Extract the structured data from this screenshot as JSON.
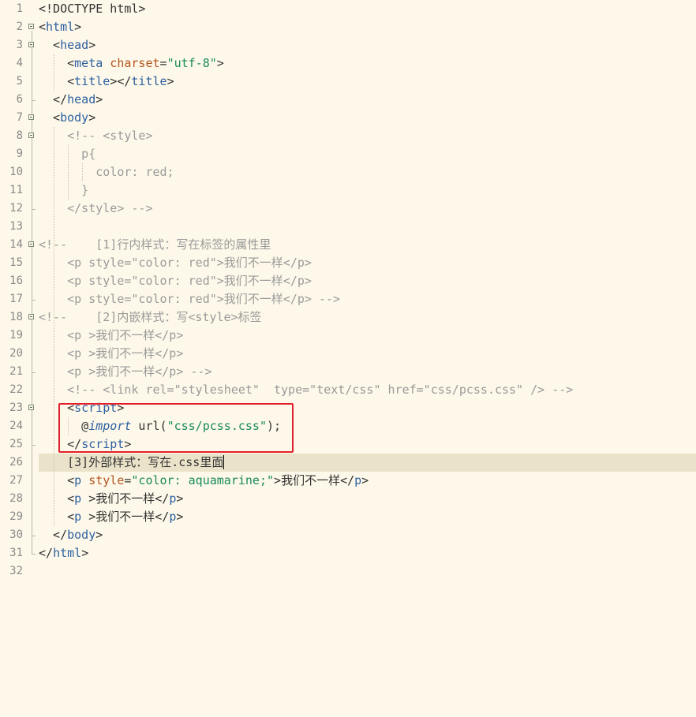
{
  "editor": {
    "line_numbers": [
      "1",
      "2",
      "3",
      "4",
      "5",
      "6",
      "7",
      "8",
      "9",
      "10",
      "11",
      "12",
      "13",
      "14",
      "15",
      "16",
      "17",
      "18",
      "19",
      "20",
      "21",
      "22",
      "23",
      "24",
      "25",
      "26",
      "27",
      "28",
      "29",
      "30",
      "31",
      "32"
    ],
    "lines": [
      [
        {
          "t": "punct",
          "s": "<!DOCTYPE html>"
        }
      ],
      [
        {
          "t": "punct",
          "s": "<"
        },
        {
          "t": "tag",
          "s": "html"
        },
        {
          "t": "punct",
          "s": ">"
        }
      ],
      [
        {
          "t": "punct",
          "s": "  <"
        },
        {
          "t": "tag",
          "s": "head"
        },
        {
          "t": "punct",
          "s": ">"
        }
      ],
      [
        {
          "t": "punct",
          "s": "    <"
        },
        {
          "t": "tag",
          "s": "meta"
        },
        {
          "t": "plain",
          "s": " "
        },
        {
          "t": "attrx",
          "s": "charset"
        },
        {
          "t": "punct",
          "s": "="
        },
        {
          "t": "str",
          "s": "\"utf-8\""
        },
        {
          "t": "punct",
          "s": ">"
        }
      ],
      [
        {
          "t": "punct",
          "s": "    <"
        },
        {
          "t": "tag",
          "s": "title"
        },
        {
          "t": "punct",
          "s": "></"
        },
        {
          "t": "tag",
          "s": "title"
        },
        {
          "t": "punct",
          "s": ">"
        }
      ],
      [
        {
          "t": "punct",
          "s": "  </"
        },
        {
          "t": "tag",
          "s": "head"
        },
        {
          "t": "punct",
          "s": ">"
        }
      ],
      [
        {
          "t": "punct",
          "s": "  <"
        },
        {
          "t": "tag",
          "s": "body"
        },
        {
          "t": "punct",
          "s": ">"
        }
      ],
      [
        {
          "t": "cm",
          "s": "    <!-- <style>"
        }
      ],
      [
        {
          "t": "cm",
          "s": "      p{"
        }
      ],
      [
        {
          "t": "cm",
          "s": "        color: red;"
        }
      ],
      [
        {
          "t": "cm",
          "s": "      }"
        }
      ],
      [
        {
          "t": "cm",
          "s": "    </style> -->"
        }
      ],
      [],
      [
        {
          "t": "cm",
          "s": "<!--    [1]行内样式：写在标签的属性里"
        }
      ],
      [
        {
          "t": "cm",
          "s": "    <p style=\"color: red\">我们不一样</p>"
        }
      ],
      [
        {
          "t": "cm",
          "s": "    <p style=\"color: red\">我们不一样</p>"
        }
      ],
      [
        {
          "t": "cm",
          "s": "    <p style=\"color: red\">我们不一样</p> -->"
        }
      ],
      [
        {
          "t": "cm",
          "s": "<!--    [2]内嵌样式：写<style>标签"
        }
      ],
      [
        {
          "t": "cm",
          "s": "    <p >我们不一样</p>"
        }
      ],
      [
        {
          "t": "cm",
          "s": "    <p >我们不一样</p>"
        }
      ],
      [
        {
          "t": "cm",
          "s": "    <p >我们不一样</p> -->"
        }
      ],
      [
        {
          "t": "cm",
          "s": "    <!-- <link rel=\"stylesheet\"  type=\"text/css\" href=\"css/pcss.css\" /> -->"
        }
      ],
      [
        {
          "t": "punct",
          "s": "    <"
        },
        {
          "t": "tag",
          "s": "script"
        },
        {
          "t": "punct",
          "s": ">"
        }
      ],
      [
        {
          "t": "plain",
          "s": "      @"
        },
        {
          "t": "kw",
          "s": "import"
        },
        {
          "t": "plain",
          "s": " url("
        },
        {
          "t": "str",
          "s": "\"css/pcss.css\""
        },
        {
          "t": "plain",
          "s": ");"
        }
      ],
      [
        {
          "t": "punct",
          "s": "    </"
        },
        {
          "t": "tag",
          "s": "script"
        },
        {
          "t": "punct",
          "s": ">"
        }
      ],
      [
        {
          "t": "text",
          "s": "    [3]外部样式：写在.css里面"
        }
      ],
      [
        {
          "t": "punct",
          "s": "    <"
        },
        {
          "t": "tag",
          "s": "p"
        },
        {
          "t": "plain",
          "s": " "
        },
        {
          "t": "attrx",
          "s": "style"
        },
        {
          "t": "punct",
          "s": "="
        },
        {
          "t": "str",
          "s": "\"color: aquamarine;\""
        },
        {
          "t": "punct",
          "s": ">"
        },
        {
          "t": "text",
          "s": "我们不一样"
        },
        {
          "t": "punct",
          "s": "</"
        },
        {
          "t": "tag",
          "s": "p"
        },
        {
          "t": "punct",
          "s": ">"
        }
      ],
      [
        {
          "t": "punct",
          "s": "    <"
        },
        {
          "t": "tag",
          "s": "p"
        },
        {
          "t": "plain",
          "s": " "
        },
        {
          "t": "punct",
          "s": ">"
        },
        {
          "t": "text",
          "s": "我们不一样"
        },
        {
          "t": "punct",
          "s": "</"
        },
        {
          "t": "tag",
          "s": "p"
        },
        {
          "t": "punct",
          "s": ">"
        }
      ],
      [
        {
          "t": "punct",
          "s": "    <"
        },
        {
          "t": "tag",
          "s": "p"
        },
        {
          "t": "plain",
          "s": " "
        },
        {
          "t": "punct",
          "s": ">"
        },
        {
          "t": "text",
          "s": "我们不一样"
        },
        {
          "t": "punct",
          "s": "</"
        },
        {
          "t": "tag",
          "s": "p"
        },
        {
          "t": "punct",
          "s": ">"
        }
      ],
      [
        {
          "t": "punct",
          "s": "  </"
        },
        {
          "t": "tag",
          "s": "body"
        },
        {
          "t": "punct",
          "s": ">"
        }
      ],
      [
        {
          "t": "punct",
          "s": "</"
        },
        {
          "t": "tag",
          "s": "html"
        },
        {
          "t": "punct",
          "s": ">"
        }
      ],
      []
    ],
    "fold_markers": [
      2,
      3,
      7,
      8,
      14,
      18,
      23
    ],
    "current_line": 26,
    "highlighted_range": {
      "from_line": 23,
      "to_line": 25,
      "color": "#e0202a"
    }
  },
  "colors": {
    "background": "#fdf8e9",
    "current_line_bg": "#ebe3c9",
    "tag": "#2d5fa0",
    "attribute": "#b3541e",
    "string": "#198a5c",
    "comment": "#9a9a9a",
    "line_number": "#8a8a8a",
    "highlight_box": "#e0202a"
  },
  "icons": {
    "fold_marker": "fold-minus-icon"
  }
}
